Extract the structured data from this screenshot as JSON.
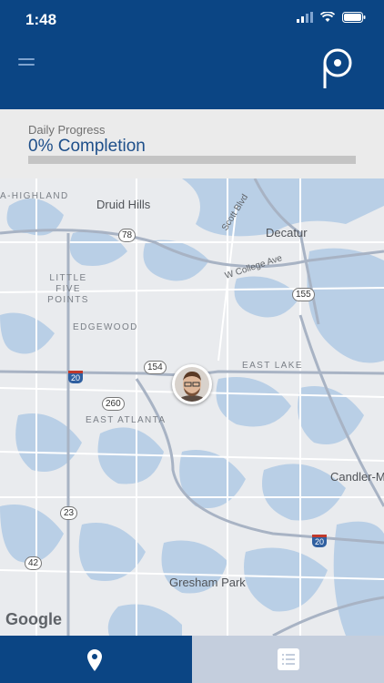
{
  "status_bar": {
    "time": "1:48"
  },
  "progress": {
    "label": "Daily Progress",
    "value_text": "0% Completion",
    "fraction": 0.0
  },
  "map": {
    "places": {
      "druid_hills": "Druid Hills",
      "decatur": "Decatur",
      "highland": "A-HIGHLAND",
      "little_five_points": "LITTLE FIVE POINTS",
      "edgewood": "EDGEWOOD",
      "east_lake": "EAST LAKE",
      "east_atlanta": "EAST ATLANTA",
      "candler": "Candler-M",
      "gresham_park": "Gresham Park"
    },
    "roads": {
      "scott_blvd": "Scott Blvd",
      "w_college_ave": "W College Ave"
    },
    "route_shields": {
      "r78": "78",
      "r155": "155",
      "r154": "154",
      "r260": "260",
      "r23": "23",
      "r42": "42",
      "i20a": "20",
      "i20b": "20"
    },
    "attribution": "Google"
  },
  "colors": {
    "brand": "#0b4584",
    "water": "#b9cfe6",
    "land": "#e9ebee"
  },
  "tabs": {
    "active": "map",
    "items": [
      "map-pin-icon",
      "list-icon"
    ]
  }
}
